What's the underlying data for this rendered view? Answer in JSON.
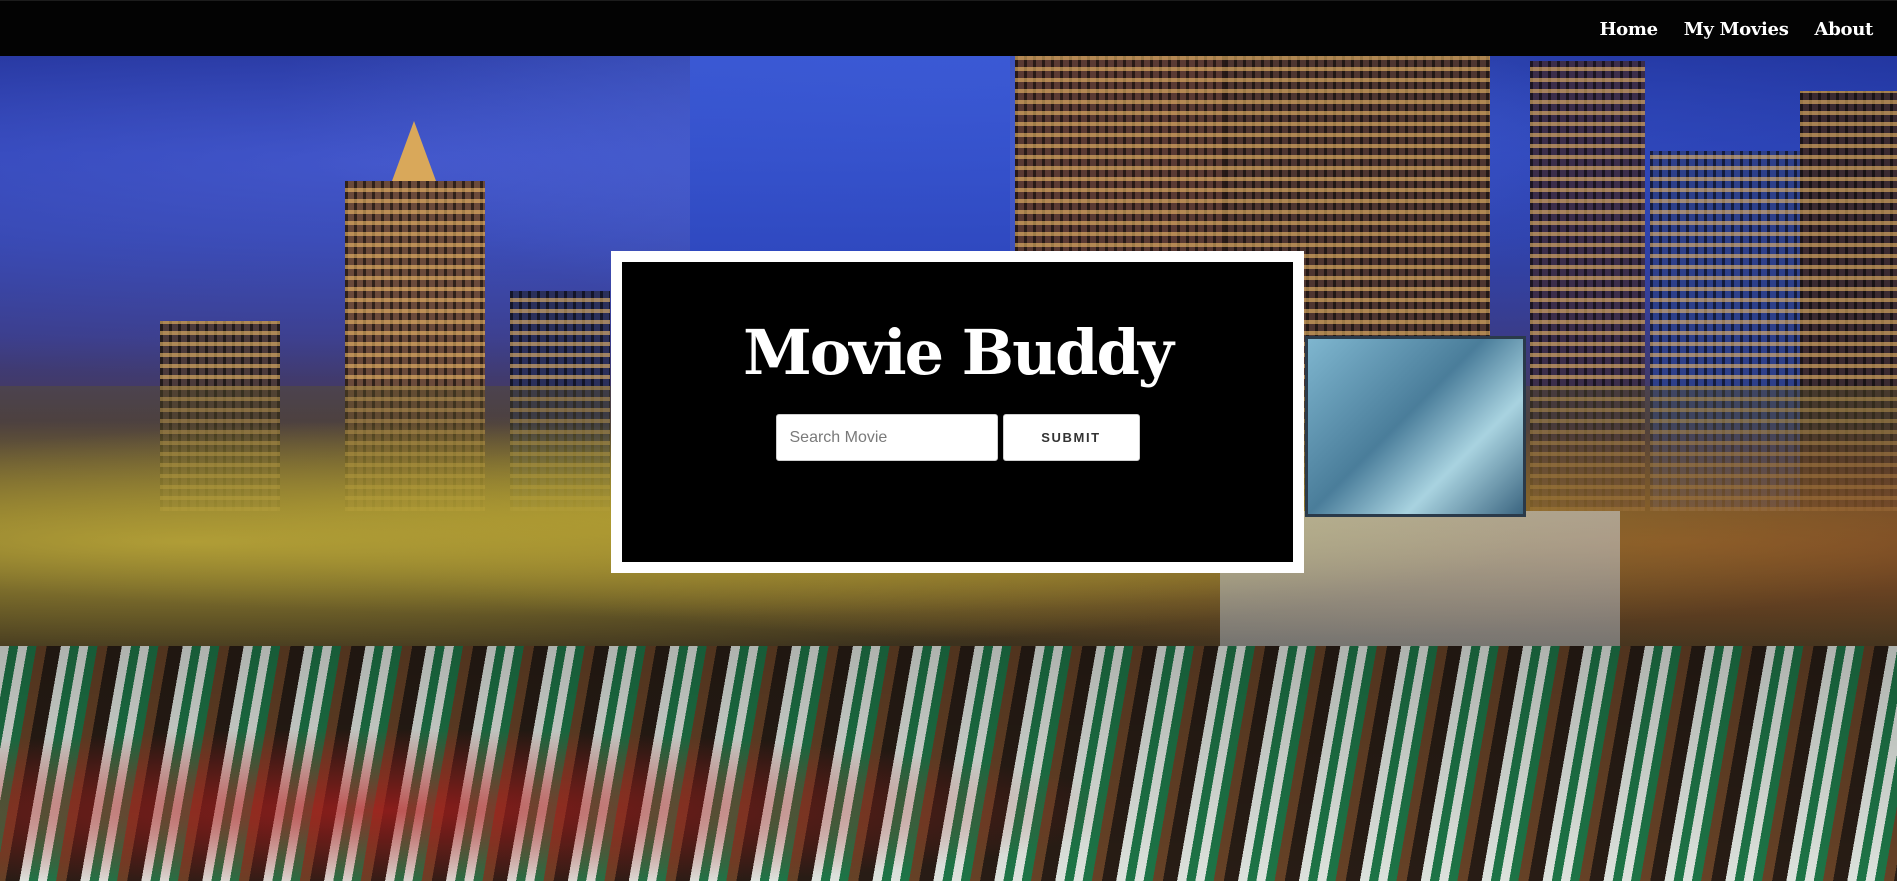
{
  "nav": {
    "links": [
      {
        "label": "Home"
      },
      {
        "label": "My Movies"
      },
      {
        "label": "About"
      }
    ]
  },
  "hero": {
    "title": "Movie Buddy",
    "search": {
      "placeholder": "Search Movie",
      "value": ""
    },
    "submit_label": "SUBMIT"
  },
  "background": {
    "description_colors": {
      "navbar": "#030303",
      "card_border": "#ffffff",
      "card_fill": "#000000"
    }
  }
}
